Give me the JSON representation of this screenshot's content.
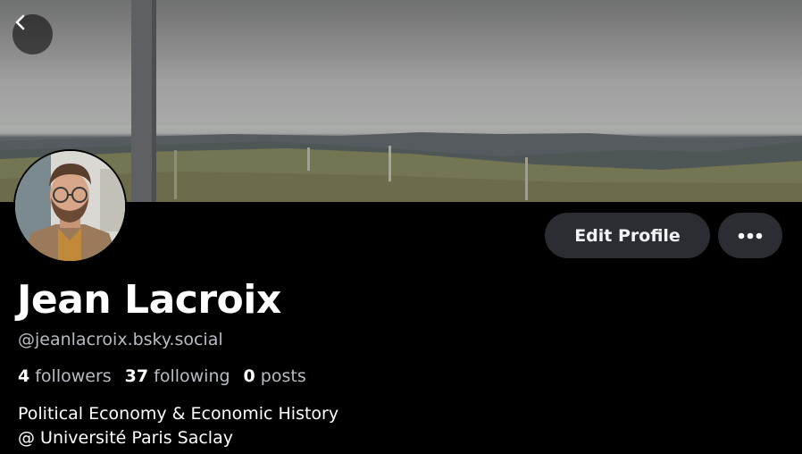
{
  "profile": {
    "name": "Jean Lacroix",
    "handle": "@jeanlacroix.bsky.social",
    "bio_line1": "Political Economy & Economic History",
    "bio_line2": "@ Université Paris Saclay"
  },
  "stats": {
    "followers_count": "4",
    "followers_label": "followers",
    "following_count": "37",
    "following_label": "following",
    "posts_count": "0",
    "posts_label": "posts"
  },
  "actions": {
    "edit_label": "Edit Profile"
  },
  "icons": {
    "back": "chevron-left-icon",
    "more": "ellipsis-icon"
  },
  "colors": {
    "background": "#000000",
    "button_bg": "#2b2d33",
    "secondary_text": "#b8bcc3"
  }
}
